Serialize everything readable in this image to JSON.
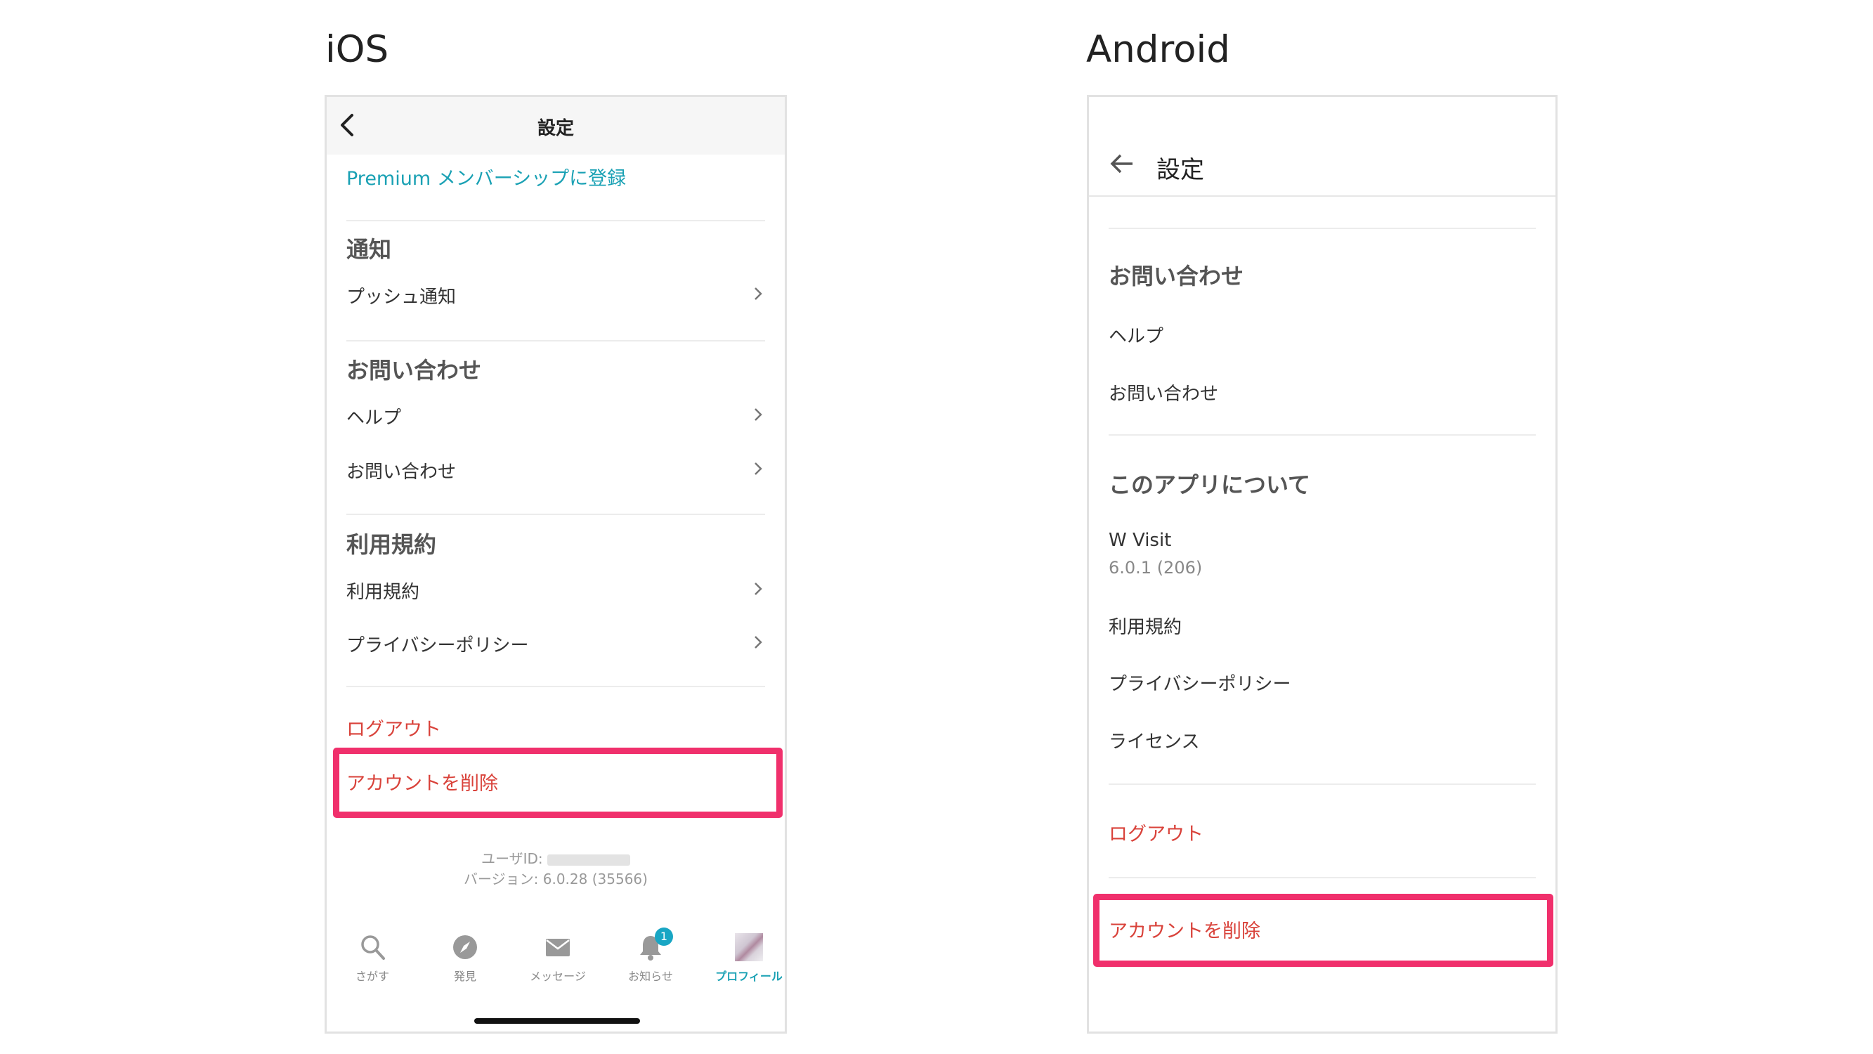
{
  "ios": {
    "heading": "iOS",
    "nav_title": "設定",
    "premium_label": "Premium メンバーシップに登録",
    "notifications": {
      "title": "通知",
      "items": [
        "プッシュ通知"
      ]
    },
    "contact": {
      "title": "お問い合わせ",
      "items": [
        "ヘルプ",
        "お問い合わせ"
      ]
    },
    "terms": {
      "title": "利用規約",
      "items": [
        "利用規約",
        "プライバシーポリシー"
      ]
    },
    "logout_label": "ログアウト",
    "delete_account_label": "アカウントを削除",
    "user_id_label": "ユーザID:",
    "version_label": "バージョン: 6.0.28 (35566)",
    "tabs": [
      {
        "icon": "search-icon",
        "label": "さがす"
      },
      {
        "icon": "compass-icon",
        "label": "発見"
      },
      {
        "icon": "envelope-icon",
        "label": "メッセージ"
      },
      {
        "icon": "bell-icon",
        "label": "お知らせ",
        "badge": "1"
      },
      {
        "icon": "avatar",
        "label": "プロフィール",
        "active": true
      }
    ]
  },
  "android": {
    "heading": "Android",
    "toolbar_title": "設定",
    "contact": {
      "title": "お問い合わせ",
      "items": [
        "ヘルプ",
        "お問い合わせ"
      ]
    },
    "about": {
      "title": "このアプリについて",
      "app_name": "W Visit",
      "app_version": "6.0.1 (206)",
      "items": [
        "利用規約",
        "プライバシーポリシー",
        "ライセンス"
      ]
    },
    "logout_label": "ログアウト",
    "delete_account_label": "アカウントを削除"
  },
  "colors": {
    "accent_teal": "#1aa1b4",
    "destructive_red": "#d9423a",
    "highlight_pink": "#f0306c"
  }
}
